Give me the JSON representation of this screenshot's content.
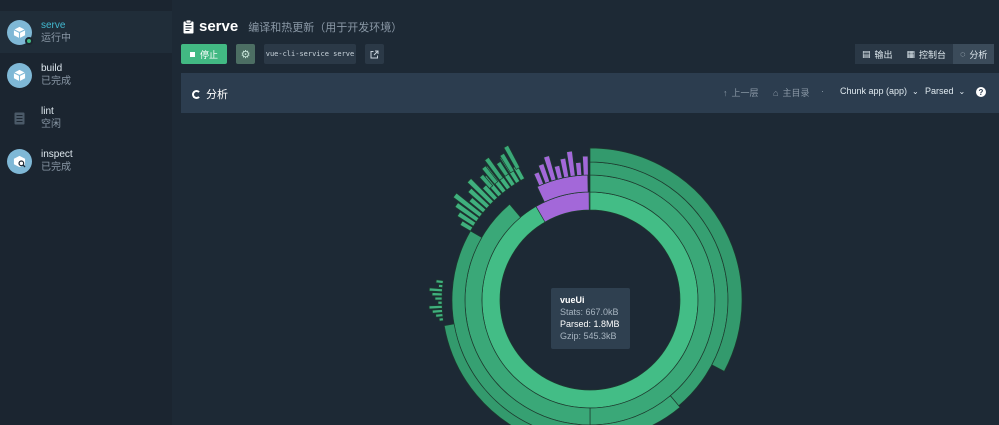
{
  "sidebar": {
    "tasks": [
      {
        "name": "serve",
        "status": "运行中",
        "icon": "cube-icon"
      },
      {
        "name": "build",
        "status": "已完成",
        "icon": "cube-icon"
      },
      {
        "name": "lint",
        "status": "空闲",
        "icon": "list-icon"
      },
      {
        "name": "inspect",
        "status": "已完成",
        "icon": "inspect-icon"
      }
    ]
  },
  "header": {
    "title": "serve",
    "subtitle": "编译和热更新（用于开发环境）"
  },
  "toolbar": {
    "stop_label": "停止",
    "command": "vue-cli-service serve"
  },
  "tabs": [
    {
      "label": "输出",
      "icon": "output-icon"
    },
    {
      "label": "控制台",
      "icon": "dashboard-icon"
    },
    {
      "label": "分析",
      "icon": "analyzer-icon",
      "active": true
    }
  ],
  "analyzer": {
    "title": "分析",
    "up_label": "上一层",
    "home_label": "主目录",
    "chunk_select": "Chunk app (app)",
    "size_select": "Parsed"
  },
  "tooltip": {
    "name": "vueUi",
    "stats": "Stats: 667.0kB",
    "parsed": "Parsed: 1.8MB",
    "gzip": "Gzip: 545.3kB"
  },
  "colors": {
    "accent": "#42b983",
    "accent_light": "#4cc48f",
    "selected": "#a368d9",
    "background": "#1d2935"
  }
}
